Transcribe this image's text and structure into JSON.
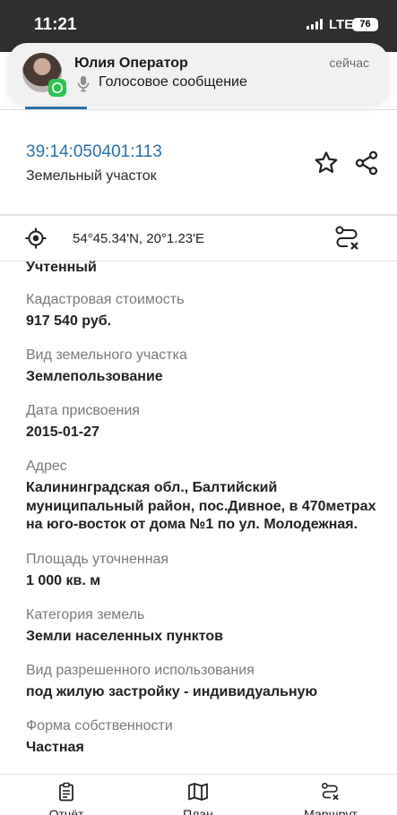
{
  "status_bar": {
    "time": "11:21",
    "network": "LTE",
    "battery": "76"
  },
  "notification": {
    "sender": "Юлия Оператор",
    "message": "Голосовое сообщение",
    "time": "сейчас",
    "app_icon": "whatsapp-icon",
    "message_icon": "microphone-icon"
  },
  "parcel": {
    "cadastral_number": "39:14:050401:113",
    "type": "Земельный участок",
    "coordinates": "54°45.34'N, 20°1.23'E"
  },
  "details": {
    "status": "Учтенный",
    "fields": [
      {
        "label": "Кадастровая стоимость",
        "value": "917 540 руб."
      },
      {
        "label": "Вид земельного участка",
        "value": "Землепользование"
      },
      {
        "label": "Дата присвоения",
        "value": "2015-01-27"
      },
      {
        "label": "Адрес",
        "value": "Калининградская обл.,  Балтийский муниципальный район, пос.Дивное, в 470метрах на  юго-восток от дома №1 по ул. Молодежная."
      },
      {
        "label": "Площадь уточненная",
        "value": "1 000 кв. м"
      },
      {
        "label": "Категория земель",
        "value": "Земли населенных пунктов"
      },
      {
        "label": "Вид разрешенного использования",
        "value": "под жилую застройку - индивидуальную"
      },
      {
        "label": "Форма собственности",
        "value": "Частная"
      }
    ]
  },
  "bottom_nav": [
    {
      "label": "Отчёт",
      "icon": "report-icon"
    },
    {
      "label": "План",
      "icon": "map-icon"
    },
    {
      "label": "Маршрут",
      "icon": "route-icon"
    }
  ],
  "colors": {
    "accent": "#2b6fa8",
    "label_text": "#7a7a7a",
    "whatsapp": "#2cc350"
  }
}
